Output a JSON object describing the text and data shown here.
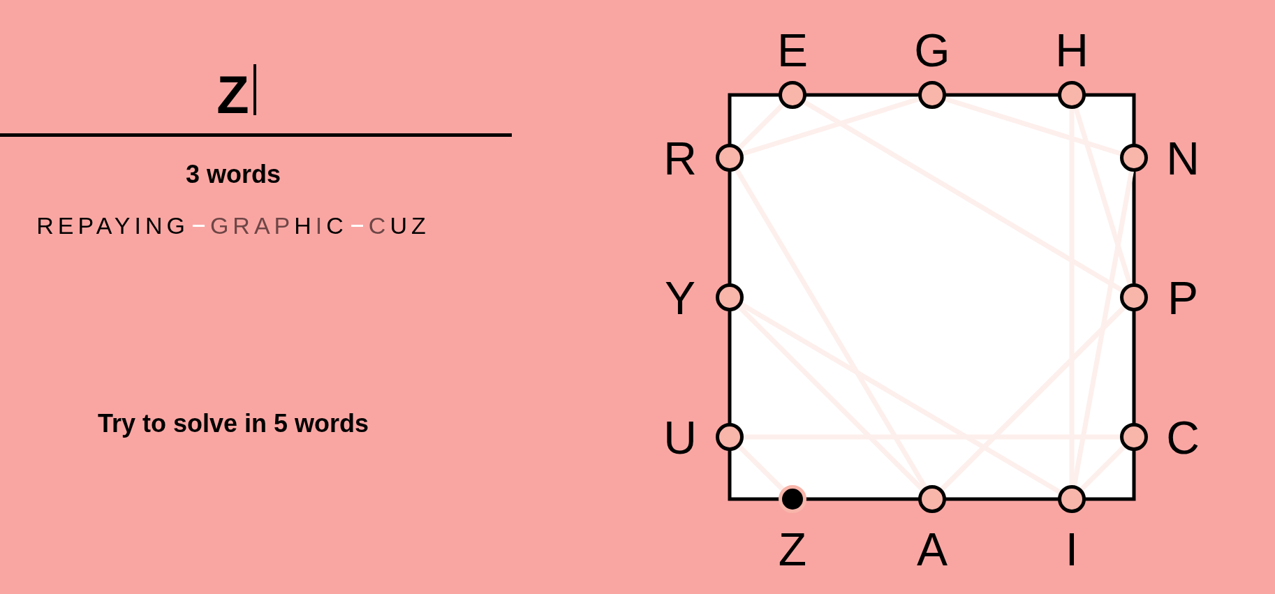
{
  "input": {
    "value": "Z",
    "focused": true
  },
  "word_count": "3 words",
  "words": [
    {
      "segments": [
        {
          "text": "REPAYING",
          "faded": false
        }
      ]
    },
    {
      "segments": [
        {
          "text": "GRAP",
          "faded": true
        },
        {
          "text": "H",
          "faded": false
        },
        {
          "text": "I",
          "faded": true
        },
        {
          "text": "C",
          "faded": false
        }
      ]
    },
    {
      "segments": [
        {
          "text": "C",
          "faded": true
        },
        {
          "text": "UZ",
          "faded": false
        }
      ]
    }
  ],
  "goal": "Try to solve in 5 words",
  "box": {
    "top": [
      {
        "char": "E",
        "used": true,
        "current": false
      },
      {
        "char": "G",
        "used": true,
        "current": false
      },
      {
        "char": "H",
        "used": true,
        "current": false
      }
    ],
    "left": [
      {
        "char": "R",
        "used": true,
        "current": false
      },
      {
        "char": "Y",
        "used": true,
        "current": false
      },
      {
        "char": "U",
        "used": true,
        "current": false
      }
    ],
    "right": [
      {
        "char": "N",
        "used": true,
        "current": false
      },
      {
        "char": "P",
        "used": true,
        "current": false
      },
      {
        "char": "C",
        "used": true,
        "current": false
      }
    ],
    "bottom": [
      {
        "char": "Z",
        "used": true,
        "current": true
      },
      {
        "char": "A",
        "used": true,
        "current": false
      },
      {
        "char": "I",
        "used": true,
        "current": false
      }
    ]
  }
}
